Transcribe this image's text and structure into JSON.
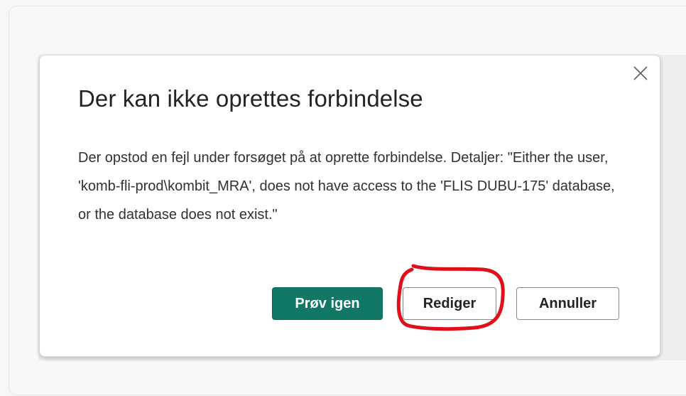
{
  "dialog": {
    "title": "Der kan ikke oprettes forbindelse",
    "message": "Der opstod en fejl under forsøget på at oprette forbindelse. Detaljer: \"Either the user, 'komb-fli-prod\\kombit_MRA', does not have access to the 'FLIS DUBU-175' database, or the database does not exist.\"",
    "close_icon": "close-icon",
    "buttons": {
      "retry_label": "Prøv igen",
      "edit_label": "Rediger",
      "cancel_label": "Annuller"
    }
  },
  "colors": {
    "primary": "#117865",
    "annotation": "#e0101a",
    "title_text": "#252423"
  }
}
